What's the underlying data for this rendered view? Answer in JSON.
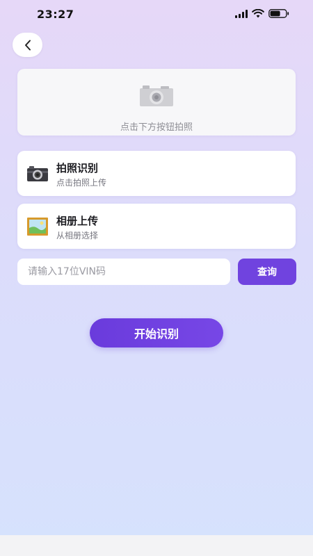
{
  "status_bar": {
    "time": "23:27",
    "icons": [
      "signal-icon",
      "wifi-icon",
      "battery-icon"
    ]
  },
  "nav": {
    "back_icon": "chevron-left-icon"
  },
  "preview": {
    "icon": "camera-placeholder-icon",
    "hint": "点击下方按钮拍照"
  },
  "options": [
    {
      "icon": "camera-icon",
      "title": "拍照识别",
      "subtitle": "点击拍照上传"
    },
    {
      "icon": "picture-frame-icon",
      "title": "相册上传",
      "subtitle": "从相册选择"
    }
  ],
  "vin": {
    "value": "",
    "placeholder": "请输入17位VIN码",
    "query_label": "查询"
  },
  "start_label": "开始识别",
  "colors": {
    "accent": "#7043df",
    "bg_top": "#e6d8f8",
    "bg_bottom": "#d6e2fd",
    "card": "#ffffff"
  }
}
